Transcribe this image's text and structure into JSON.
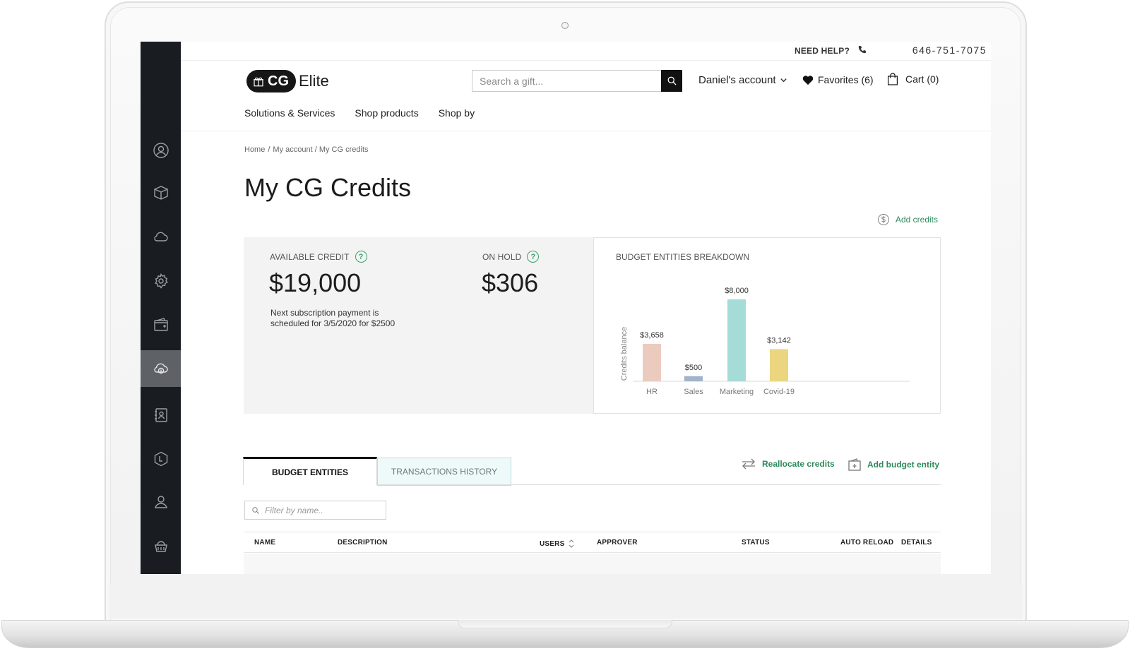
{
  "topbar": {
    "need_help": "NEED HELP?",
    "phone": "646-751-7075"
  },
  "brand": {
    "logo_mark": "CG",
    "logo_word": "Elite"
  },
  "search": {
    "placeholder": "Search a gift..."
  },
  "account_menu": {
    "label": "Daniel's account"
  },
  "favorites": {
    "label": "Favorites (6)"
  },
  "cart": {
    "label": "Cart (0)"
  },
  "mainnav": {
    "items": [
      {
        "label": "Solutions & Services"
      },
      {
        "label": "Shop products"
      },
      {
        "label": "Shop by"
      }
    ]
  },
  "breadcrumb": {
    "home": "Home",
    "sep": "/",
    "trail": "My account / My CG credits"
  },
  "page": {
    "title": "My CG Credits",
    "add_credits": "Add credits"
  },
  "credits": {
    "available_label": "AVAILABLE CREDIT",
    "available_value": "$19,000",
    "hold_label": "ON HOLD",
    "hold_value": "$306",
    "note": "Next subscription payment is scheduled for 3/5/2020 for $2500"
  },
  "chart_data": {
    "type": "bar",
    "title": "BUDGET ENTITIES BREAKDOWN",
    "ylabel": "Credits balance",
    "xlabel": "",
    "categories": [
      "HR",
      "Sales",
      "Marketing",
      "Covid-19"
    ],
    "values": [
      3658,
      500,
      8000,
      3142
    ],
    "value_labels": [
      "$3,658",
      "$500",
      "$8,000",
      "$3,142"
    ],
    "colors": [
      "#eccbbf",
      "#a3b3cb",
      "#a5dcd8",
      "#ebd67f"
    ],
    "ylim": [
      0,
      8000
    ],
    "grid": false,
    "legend": "none"
  },
  "tabs": [
    {
      "label": "BUDGET ENTITIES",
      "active": true
    },
    {
      "label": "TRANSACTIONS HISTORY",
      "active": false
    }
  ],
  "actions": {
    "reallocate": "Reallocate credits",
    "add_entity": "Add budget entity"
  },
  "filter": {
    "placeholder": "Filter by name.."
  },
  "table": {
    "columns": [
      "NAME",
      "DESCRIPTION",
      "USERS",
      "APPROVER",
      "STATUS",
      "AUTO RELOAD",
      "DETAILS"
    ]
  },
  "sidenav": {
    "icons": [
      "user-icon",
      "box-icon",
      "cloud-icon",
      "settings-icon",
      "wallet-icon",
      "cloud-credit-icon",
      "contacts-icon",
      "logistics-icon",
      "profile-icon",
      "gift-basket-icon"
    ],
    "active_index": 5
  },
  "theme": {
    "accent": "#2d8a5b",
    "sidebar": "#191c21"
  }
}
